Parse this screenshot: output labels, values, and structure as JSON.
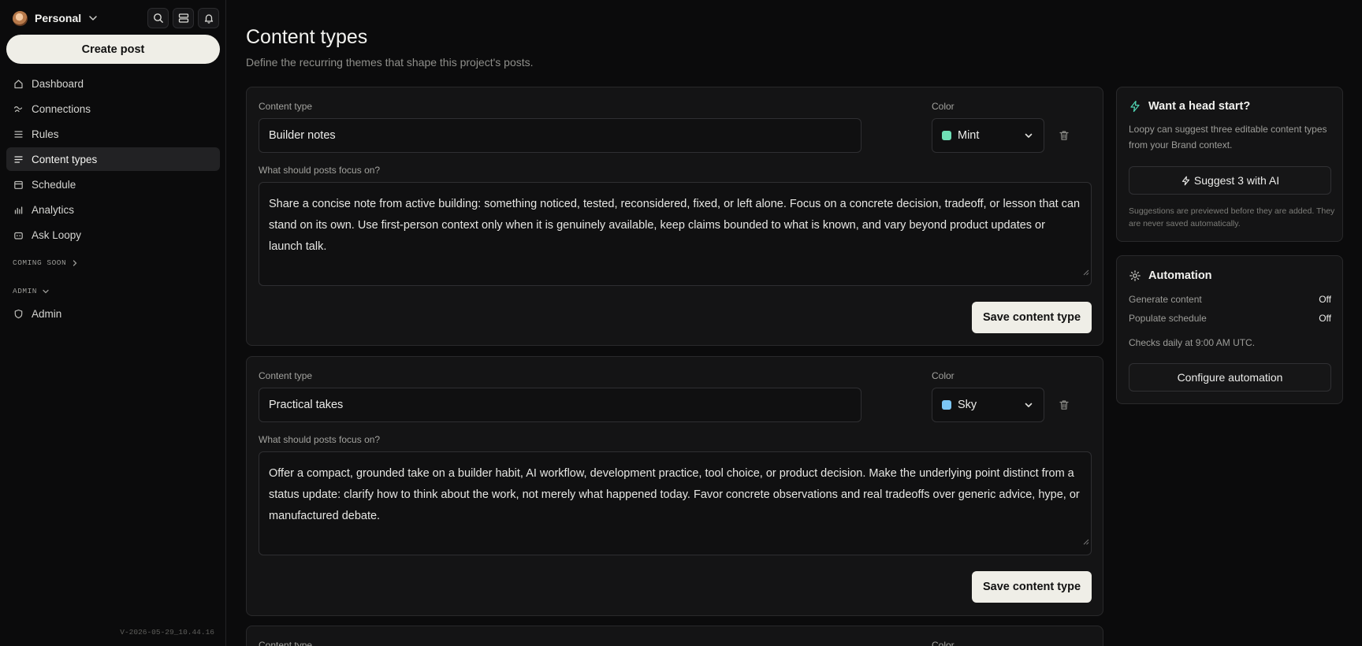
{
  "sidebar": {
    "workspace": "Personal",
    "create_post": "Create post",
    "nav": [
      {
        "label": "Dashboard",
        "icon": "home-icon"
      },
      {
        "label": "Connections",
        "icon": "connections-icon"
      },
      {
        "label": "Rules",
        "icon": "list-icon"
      },
      {
        "label": "Content types",
        "icon": "lines-icon",
        "active": true
      },
      {
        "label": "Schedule",
        "icon": "calendar-icon"
      },
      {
        "label": "Analytics",
        "icon": "bar-chart-icon"
      },
      {
        "label": "Ask Loopy",
        "icon": "bot-icon"
      }
    ],
    "coming_soon": "COMING SOON",
    "admin_section": "ADMIN",
    "admin_item": "Admin",
    "version": "V-2026-05-29_10.44.16"
  },
  "main": {
    "title": "Content types",
    "subtitle": "Define the recurring themes that shape this project's posts.",
    "labels": {
      "content_type": "Content type",
      "color": "Color",
      "focus": "What should posts focus on?",
      "save": "Save content type"
    },
    "cards": [
      {
        "name": "Builder notes",
        "color_name": "Mint",
        "color_hex": "#6fe0b6",
        "focus": "Share a concise note from active building: something noticed, tested, reconsidered, fixed, or left alone. Focus on a concrete decision, tradeoff, or lesson that can stand on its own. Use first-person context only when it is genuinely available, keep claims bounded to what is known, and vary beyond product updates or launch talk."
      },
      {
        "name": "Practical takes",
        "color_name": "Sky",
        "color_hex": "#7cc6f5",
        "focus": "Offer a compact, grounded take on a builder habit, AI workflow, development practice, tool choice, or product decision. Make the underlying point distinct from a status update: clarify how to think about the work, not merely what happened today. Favor concrete observations and real tradeoffs over generic advice, hype, or manufactured debate."
      }
    ],
    "partial_card": {
      "content_type_label": "Content type",
      "color_label": "Color"
    }
  },
  "head_start": {
    "title": "Want a head start?",
    "text": "Loopy can suggest three editable content types from your Brand context.",
    "button": "Suggest 3 with AI",
    "note": "Suggestions are previewed before they are added. They are never saved automatically."
  },
  "automation": {
    "title": "Automation",
    "rows": [
      {
        "label": "Generate content",
        "value": "Off"
      },
      {
        "label": "Populate schedule",
        "value": "Off"
      }
    ],
    "checks": "Checks daily at 9:00 AM UTC.",
    "button": "Configure automation"
  },
  "colors": {
    "accent_green": "#4fd1b0",
    "button_bg": "#efeee7"
  }
}
